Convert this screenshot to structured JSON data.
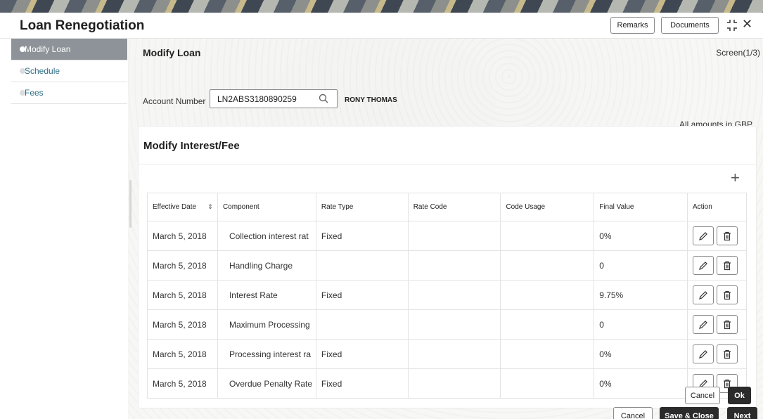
{
  "window": {
    "title": "Loan Renegotiation",
    "remarks_label": "Remarks",
    "documents_label": "Documents"
  },
  "sidebar": {
    "items": [
      {
        "label": "Modify Loan",
        "active": true
      },
      {
        "label": "Schedule",
        "active": false
      },
      {
        "label": "Fees",
        "active": false
      }
    ]
  },
  "main": {
    "section_title": "Modify Loan",
    "screen_indicator": "Screen(1/3)",
    "account_label": "Account Number",
    "account_value": "LN2ABS3180890259",
    "customer_name": "RONY THOMAS",
    "amounts_note": "All amounts in GBP"
  },
  "panel": {
    "title": "Modify Interest/Fee",
    "columns": [
      "Effective Date",
      "Component",
      "Rate Type",
      "Rate Code",
      "Code Usage",
      "Final Value",
      "Action"
    ],
    "rows": [
      {
        "date": "March 5, 2018",
        "component": "Collection interest rat",
        "rate_type": "Fixed",
        "rate_code": "",
        "code_usage": "",
        "final_value": "0%"
      },
      {
        "date": "March 5, 2018",
        "component": "Handling Charge",
        "rate_type": "",
        "rate_code": "",
        "code_usage": "",
        "final_value": "0"
      },
      {
        "date": "March 5, 2018",
        "component": "Interest Rate",
        "rate_type": "Fixed",
        "rate_code": "",
        "code_usage": "",
        "final_value": "9.75%"
      },
      {
        "date": "March 5, 2018",
        "component": "Maximum Processing",
        "rate_type": "",
        "rate_code": "",
        "code_usage": "",
        "final_value": "0"
      },
      {
        "date": "March 5, 2018",
        "component": "Processing interest ra",
        "rate_type": "Fixed",
        "rate_code": "",
        "code_usage": "",
        "final_value": "0%"
      },
      {
        "date": "March 5, 2018",
        "component": "Overdue Penalty Rate",
        "rate_type": "Fixed",
        "rate_code": "",
        "code_usage": "",
        "final_value": "0%"
      }
    ],
    "cancel_label": "Cancel",
    "ok_label": "Ok"
  },
  "footer": {
    "cancel_label": "Cancel",
    "save_close_label": "Save & Close",
    "next_label": "Next"
  },
  "icons": {
    "search": "search-icon",
    "add": "plus-icon",
    "edit": "pencil-icon",
    "delete": "trash-icon",
    "minimize": "minimize-icon",
    "close": "close-icon",
    "sort": "sort-icon"
  },
  "colors": {
    "active_sidebar": "#8d9398",
    "primary_button": "#2b2b2b",
    "link_text": "#2f6f86"
  }
}
